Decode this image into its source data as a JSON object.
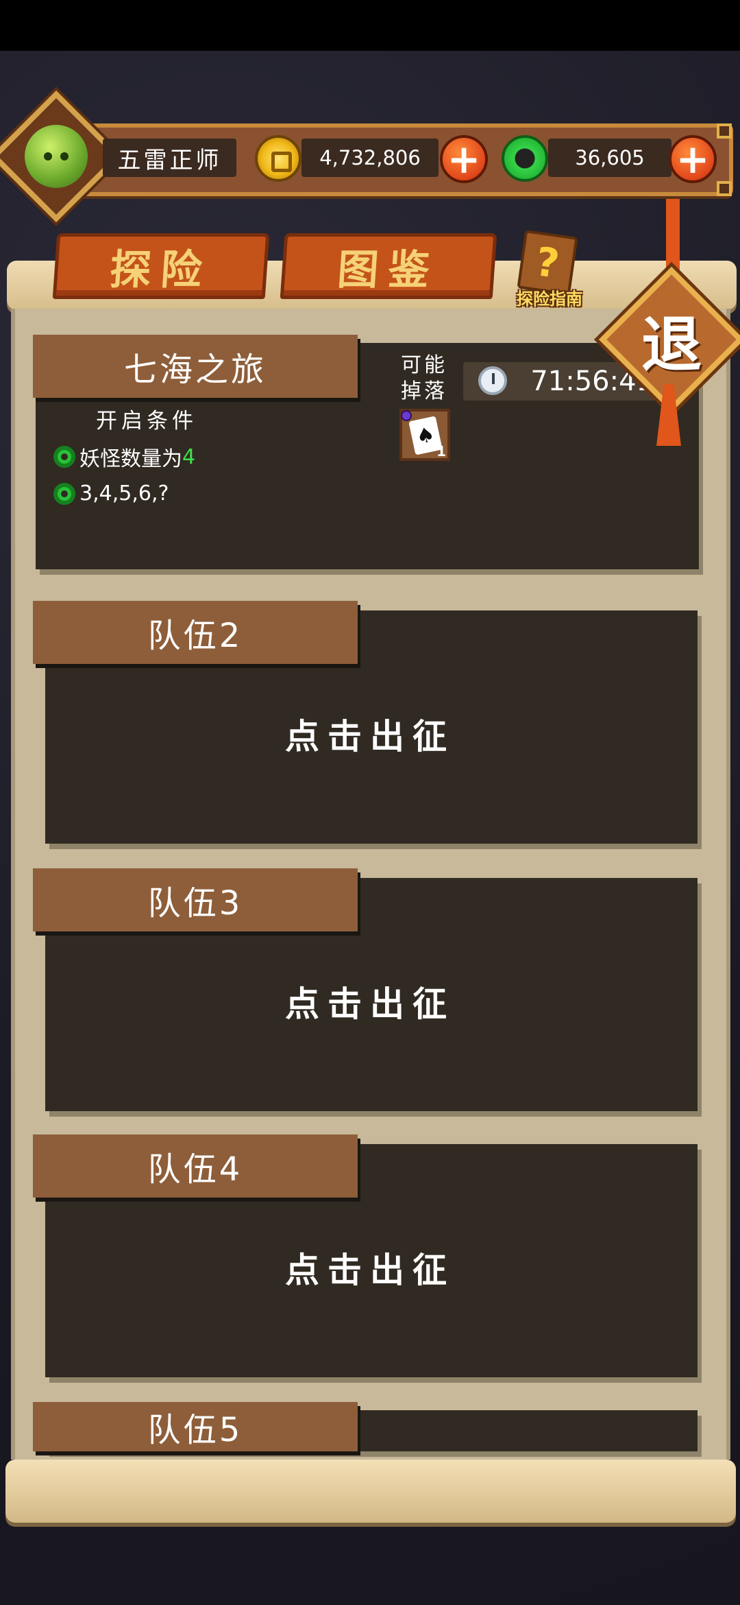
{
  "player": {
    "name": "五雷正师"
  },
  "resources": {
    "gold": "4,732,806",
    "jade": "36,605"
  },
  "tabs": [
    {
      "label": "探险"
    },
    {
      "label": "图鉴"
    }
  ],
  "guide": {
    "label": "探险指南"
  },
  "exit": {
    "label": "退"
  },
  "expedition": {
    "title": "七海之旅",
    "condition_title": "开启条件",
    "conditions": [
      {
        "text": "妖怪数量为",
        "value": "4"
      },
      {
        "text": "3,4,5,6,?"
      }
    ],
    "drop_label": "可能掉落",
    "timer": "71:56:41",
    "drop_item": {
      "qty": "1"
    }
  },
  "teams": [
    {
      "label": "队伍2",
      "action": "点击出征"
    },
    {
      "label": "队伍3",
      "action": "点击出征"
    },
    {
      "label": "队伍4",
      "action": "点击出征"
    },
    {
      "label": "队伍5"
    }
  ],
  "colors": {
    "tab_bg": "#c4531a",
    "tab_text": "#f6d277",
    "card_bg": "#302a22",
    "label_bg": "#8e5e3a",
    "highlight": "#3ee04a"
  }
}
